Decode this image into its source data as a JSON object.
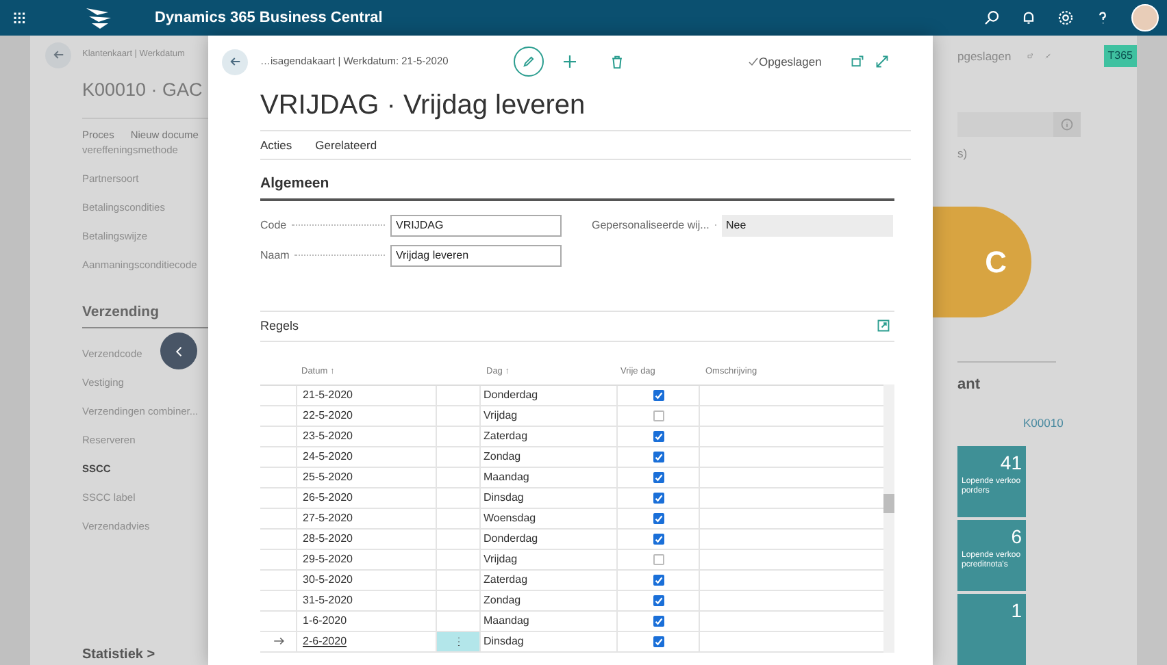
{
  "top_bar": {
    "title": "Dynamics 365 Business Central"
  },
  "background_page": {
    "breadcrumb": "Klantenkaart | Werkdatum",
    "title": "K00010 · GAC",
    "actions": [
      "Proces",
      "Nieuw docume"
    ],
    "fields": [
      {
        "label": "vereffeningsmethode",
        "bold": false
      },
      {
        "label": "Partnersoort",
        "bold": false
      },
      {
        "label": "Betalingscondities",
        "bold": false
      },
      {
        "label": "Betalingswijze",
        "bold": false
      },
      {
        "label": "Aanmaningsconditiecode",
        "bold": false
      }
    ],
    "section": "Verzending",
    "shipping_fields": [
      {
        "label": "Verzendcode",
        "bold": false
      },
      {
        "label": "Vestiging",
        "bold": false
      },
      {
        "label": "Verzendingen combiner...",
        "bold": false
      },
      {
        "label": "Reserveren",
        "bold": false
      },
      {
        "label": "SSCC",
        "bold": true
      },
      {
        "label": "SSCC label",
        "bold": false
      },
      {
        "label": "Verzendadvies",
        "bold": false
      }
    ],
    "footer": "Statistiek >",
    "right": {
      "status": "pgeslagen",
      "badge": "T365",
      "partial_text": "s)",
      "circle_letter": "C",
      "heading": "ant",
      "customer_no": "K00010",
      "tiles": [
        {
          "value": "41",
          "label": "Lopende verkooporders"
        },
        {
          "value": "6",
          "label": "Lopende verkoopcreditnota's"
        },
        {
          "value": "1"
        }
      ]
    }
  },
  "modal": {
    "breadcrumb": "…isagendakaart | Werkdatum: 21-5-2020",
    "status": "Opgeslagen",
    "title": "VRIJDAG · Vrijdag leveren",
    "tabs": [
      "Acties",
      "Gerelateerd"
    ],
    "general": {
      "heading": "Algemeen",
      "columns": [
        [
          {
            "label": "Code",
            "value": "VRIJDAG",
            "kind": "input"
          },
          {
            "label": "Naam",
            "value": "Vrijdag leveren",
            "kind": "input"
          }
        ],
        [
          {
            "label": "Gepersonaliseerde wij...",
            "value": "Nee",
            "kind": "readonly"
          }
        ]
      ]
    },
    "lines": {
      "heading": "Regels",
      "columns": [
        "Datum ↑",
        "Dag ↑",
        "Vrije dag",
        "Omschrijving"
      ],
      "rows": [
        {
          "date": "21-5-2020",
          "day": "Donderdag",
          "checked": true,
          "selected": false
        },
        {
          "date": "22-5-2020",
          "day": "Vrijdag",
          "checked": false,
          "selected": false
        },
        {
          "date": "23-5-2020",
          "day": "Zaterdag",
          "checked": true,
          "selected": false
        },
        {
          "date": "24-5-2020",
          "day": "Zondag",
          "checked": true,
          "selected": false
        },
        {
          "date": "25-5-2020",
          "day": "Maandag",
          "checked": true,
          "selected": false
        },
        {
          "date": "26-5-2020",
          "day": "Dinsdag",
          "checked": true,
          "selected": false
        },
        {
          "date": "27-5-2020",
          "day": "Woensdag",
          "checked": true,
          "selected": false
        },
        {
          "date": "28-5-2020",
          "day": "Donderdag",
          "checked": true,
          "selected": false
        },
        {
          "date": "29-5-2020",
          "day": "Vrijdag",
          "checked": false,
          "selected": false
        },
        {
          "date": "30-5-2020",
          "day": "Zaterdag",
          "checked": true,
          "selected": false
        },
        {
          "date": "31-5-2020",
          "day": "Zondag",
          "checked": true,
          "selected": false
        },
        {
          "date": "1-6-2020",
          "day": "Maandag",
          "checked": true,
          "selected": false
        },
        {
          "date": "2-6-2020",
          "day": "Dinsdag",
          "checked": true,
          "selected": true
        }
      ]
    }
  }
}
